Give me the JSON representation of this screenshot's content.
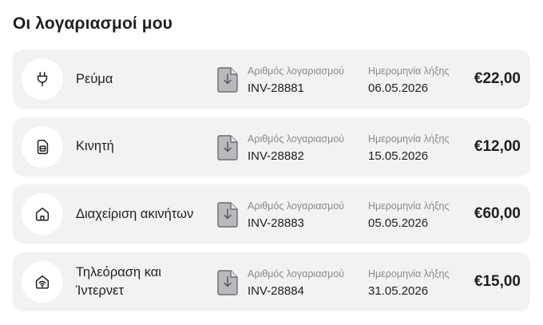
{
  "page": {
    "title": "Οι λογαριασμοί μου"
  },
  "labels": {
    "account_number": "Αριθμός λογαριασμού",
    "due_date": "Ημερομηνία λήξης"
  },
  "bills": [
    {
      "name": "Ρεύμα",
      "icon": "plug-icon",
      "account": "INV-28881",
      "due": "06.05.2026",
      "amount": "€22,00"
    },
    {
      "name": "Κινητή",
      "icon": "sim-card-icon",
      "account": "INV-28882",
      "due": "15.05.2026",
      "amount": "€12,00"
    },
    {
      "name": "Διαχείριση ακινήτων",
      "icon": "house-icon",
      "account": "INV-28883",
      "due": "05.05.2026",
      "amount": "€60,00"
    },
    {
      "name": "Τηλεόραση και Ίντερνετ",
      "icon": "wifi-router-icon",
      "account": "INV-28884",
      "due": "31.05.2026",
      "amount": "€15,00"
    }
  ]
}
